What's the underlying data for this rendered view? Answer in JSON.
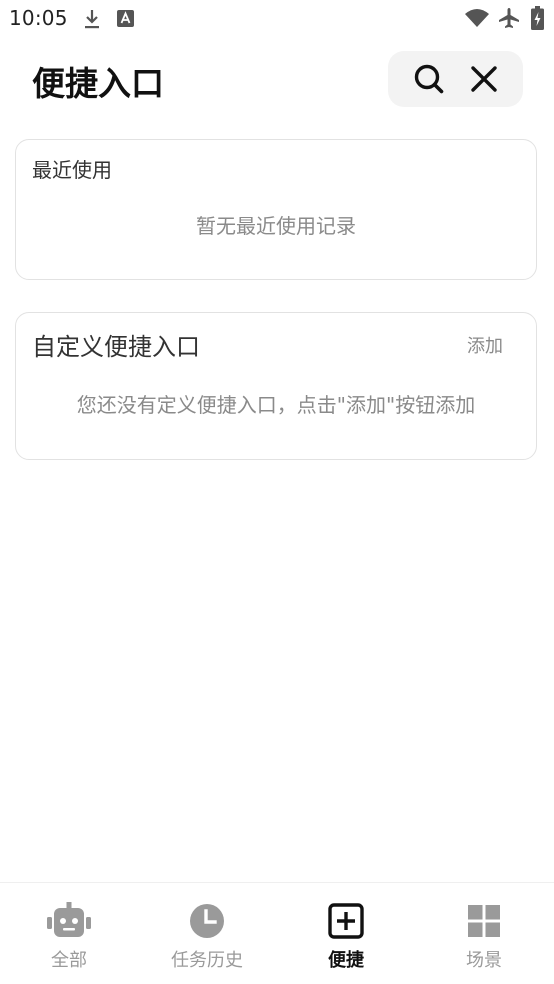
{
  "status_bar": {
    "time": "10:05"
  },
  "header": {
    "title": "便捷入口"
  },
  "recent": {
    "title": "最近使用",
    "empty_text": "暂无最近使用记录"
  },
  "custom": {
    "title": "自定义便捷入口",
    "add_label": "添加",
    "empty_text": "您还没有定义便捷入口，点击\"添加\"按钮添加"
  },
  "bottom_nav": {
    "items": [
      {
        "label": "全部",
        "icon": "robot-icon"
      },
      {
        "label": "任务历史",
        "icon": "clock-icon"
      },
      {
        "label": "便捷",
        "icon": "plus-square-icon",
        "active": true
      },
      {
        "label": "场景",
        "icon": "grid-icon"
      }
    ]
  },
  "colors": {
    "text_primary": "#111111",
    "text_muted": "#8a8a8a",
    "nav_inactive": "#9a9a9a",
    "card_border": "#e2e2e2",
    "action_bg": "#f3f3f3"
  }
}
